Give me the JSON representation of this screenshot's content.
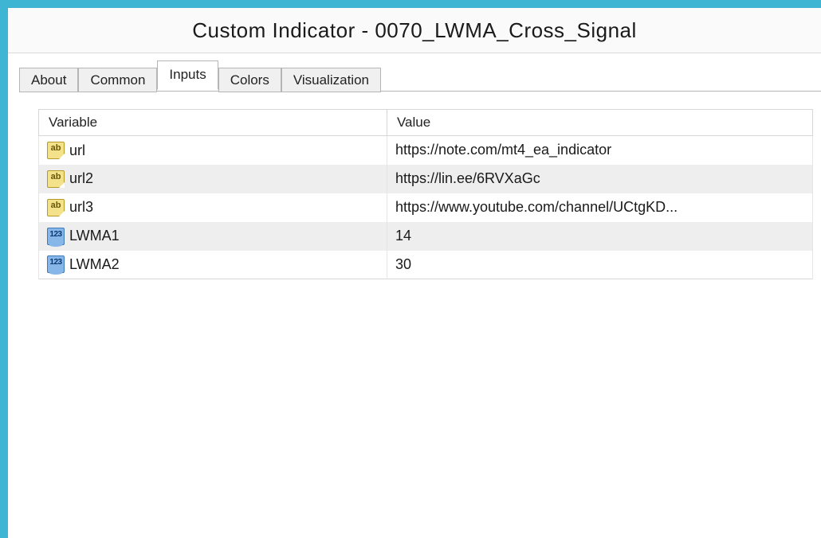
{
  "title": "Custom Indicator - 0070_LWMA_Cross_Signal",
  "tabs": {
    "about": "About",
    "common": "Common",
    "inputs": "Inputs",
    "colors": "Colors",
    "visualization": "Visualization",
    "active": "inputs"
  },
  "grid": {
    "headers": {
      "variable": "Variable",
      "value": "Value"
    },
    "rows": [
      {
        "type": "string",
        "name": "url",
        "value": "https://note.com/mt4_ea_indicator"
      },
      {
        "type": "string",
        "name": "url2",
        "value": "https://lin.ee/6RVXaGc"
      },
      {
        "type": "string",
        "name": "url3",
        "value": "https://www.youtube.com/channel/UCtgKD..."
      },
      {
        "type": "int",
        "name": "LWMA1",
        "value": "14"
      },
      {
        "type": "int",
        "name": "LWMA2",
        "value": "30"
      }
    ]
  }
}
